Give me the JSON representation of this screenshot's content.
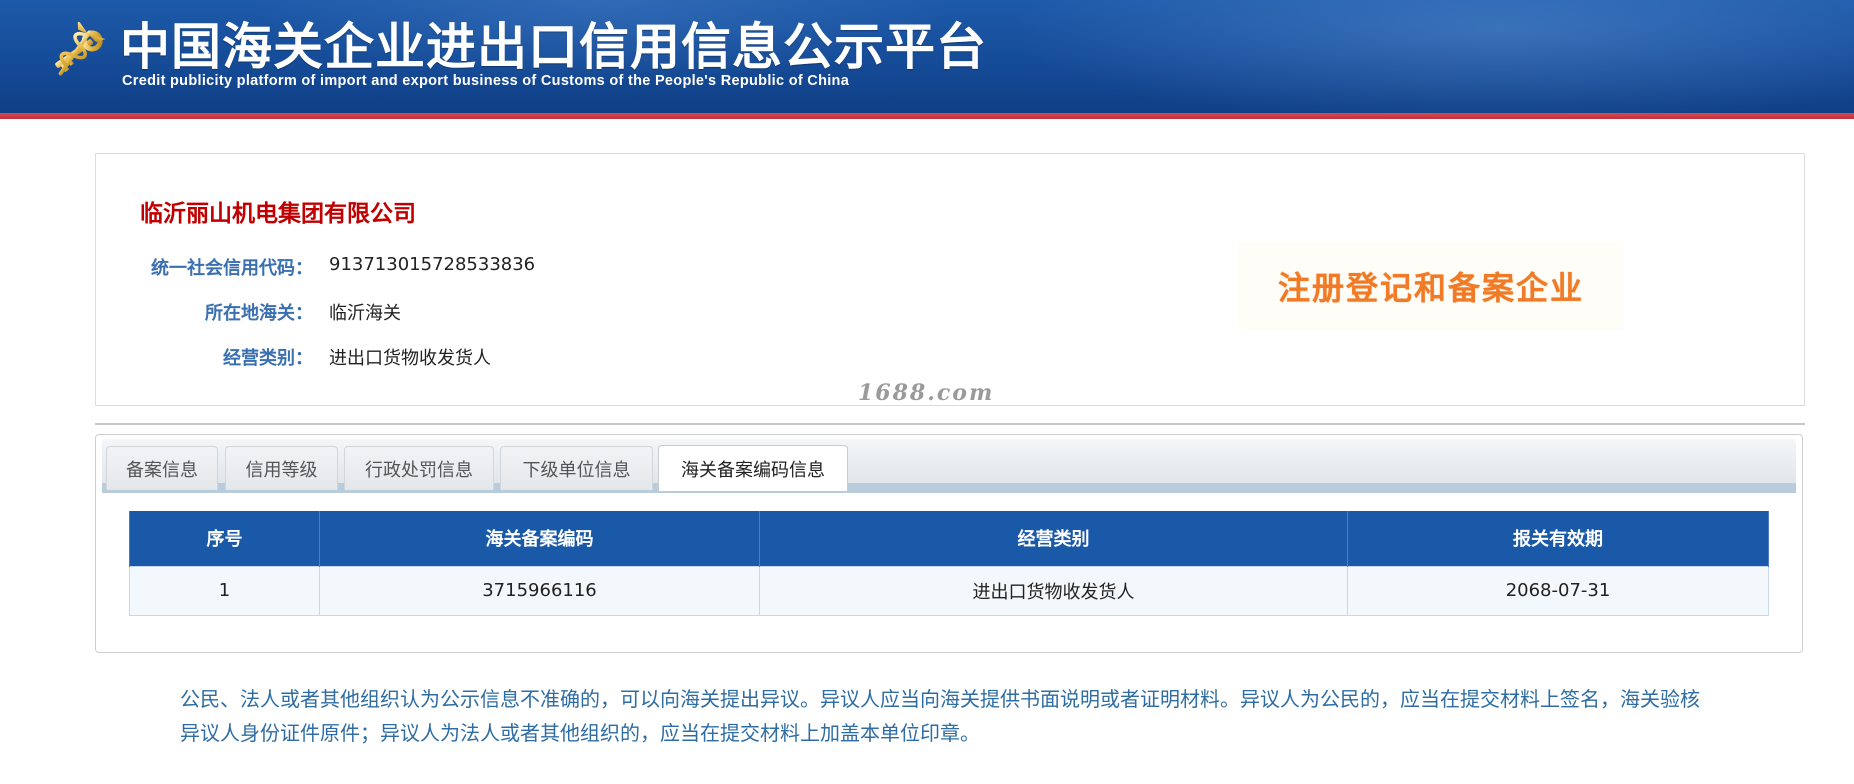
{
  "banner": {
    "title": "中国海关企业进出口信用信息公示平台",
    "subtitle": "Credit publicity platform of import and export business of Customs of the People's Republic of China",
    "logo_icon": "customs-emblem-icon"
  },
  "company": {
    "name": "临沂丽山机电集团有限公司",
    "fields": [
      {
        "label": "统一社会信用代码：",
        "value": "913713015728533836"
      },
      {
        "label": "所在地海关：",
        "value": "临沂海关"
      },
      {
        "label": "经营类别：",
        "value": "进出口货物收发货人"
      }
    ],
    "stamp": "注册登记和备案企业",
    "watermark": "1688.com"
  },
  "tabs": [
    {
      "label": "备案信息",
      "active": false
    },
    {
      "label": "信用等级",
      "active": false
    },
    {
      "label": "行政处罚信息",
      "active": false
    },
    {
      "label": "下级单位信息",
      "active": false
    },
    {
      "label": "海关备案编码信息",
      "active": true
    }
  ],
  "table": {
    "headers": [
      "序号",
      "海关备案编码",
      "经营类别",
      "报关有效期"
    ],
    "rows": [
      [
        "1",
        "3715966116",
        "进出口货物收发货人",
        "2068-07-31"
      ]
    ]
  },
  "notice": "公民、法人或者其他组织认为公示信息不准确的，可以向海关提出异议。异议人应当向海关提供书面说明或者证明材料。异议人为公民的，应当在提交材料上签名，海关验核异议人身份证件原件；异议人为法人或者其他组织的，应当在提交材料上加盖本单位印章。",
  "colors": {
    "banner_blue": "#174e9b",
    "banner_red_line": "#c3303a",
    "company_name_red": "#c00000",
    "label_blue": "#3a6fb0",
    "table_header_blue": "#1a58a8",
    "stamp_orange": "#f07a25",
    "notice_blue": "#2e6da4"
  }
}
